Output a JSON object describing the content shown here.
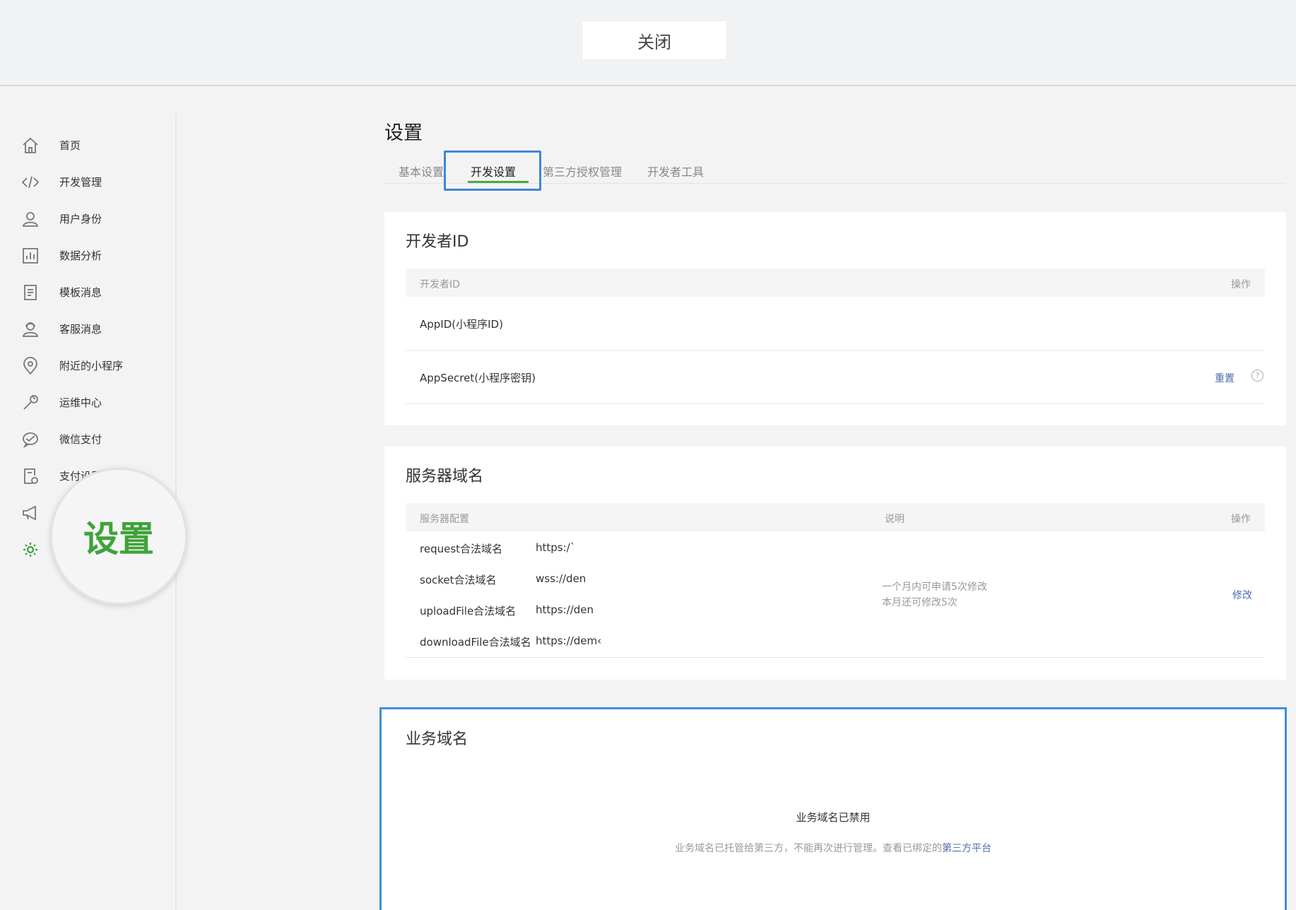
{
  "topbar": {
    "close_label": "关闭"
  },
  "sidebar": {
    "items": [
      {
        "label": "首页",
        "icon": "home-icon"
      },
      {
        "label": "开发管理",
        "icon": "code-icon"
      },
      {
        "label": "用户身份",
        "icon": "user-icon"
      },
      {
        "label": "数据分析",
        "icon": "chart-icon"
      },
      {
        "label": "模板消息",
        "icon": "document-icon"
      },
      {
        "label": "客服消息",
        "icon": "service-icon"
      },
      {
        "label": "附近的小程序",
        "icon": "location-icon"
      },
      {
        "label": "运维中心",
        "icon": "wrench-icon"
      },
      {
        "label": "微信支付",
        "icon": "wechat-pay-icon"
      },
      {
        "label": "支付设置",
        "icon": "pay-settings-icon"
      },
      {
        "label": "",
        "icon": "megaphone-icon"
      },
      {
        "label": "",
        "icon": "gear-icon"
      }
    ],
    "magnifier_label": "设置",
    "accent_color": "#3fa33a"
  },
  "main": {
    "title": "设置",
    "tabs": [
      {
        "label": "基本设置"
      },
      {
        "label": "开发设置",
        "active": true
      },
      {
        "label": "第三方授权管理"
      },
      {
        "label": "开发者工具"
      }
    ],
    "developer_id": {
      "title": "开发者ID",
      "col_id": "开发者ID",
      "col_action": "操作",
      "appid_label": "AppID(小程序ID)",
      "appsecret_label": "AppSecret(小程序密钥)",
      "reset_label": "重置",
      "help_icon": "question-circle-icon"
    },
    "server_domain": {
      "title": "服务器域名",
      "col_config": "服务器配置",
      "col_desc": "说明",
      "col_action": "操作",
      "rows": [
        {
          "label": "request合法域名",
          "value": "https:/`"
        },
        {
          "label": "socket合法域名",
          "value": "wss://den"
        },
        {
          "label": "uploadFile合法域名",
          "value": "https://den"
        },
        {
          "label": "downloadFile合法域名",
          "value": "https://dem‹"
        }
      ],
      "desc_line1": "一个月内可申请5次修改",
      "desc_line2": "本月还可修改5次",
      "modify_label": "修改"
    },
    "business_domain": {
      "title": "业务域名",
      "disabled_title": "业务域名已禁用",
      "disabled_desc": "业务域名已托管给第三方，不能再次进行管理。查看已绑定的",
      "third_party_link": "第三方平台"
    }
  },
  "colors": {
    "link": "#4f6ca8",
    "focus": "#3b88d8",
    "active_tab": "#48a843"
  }
}
